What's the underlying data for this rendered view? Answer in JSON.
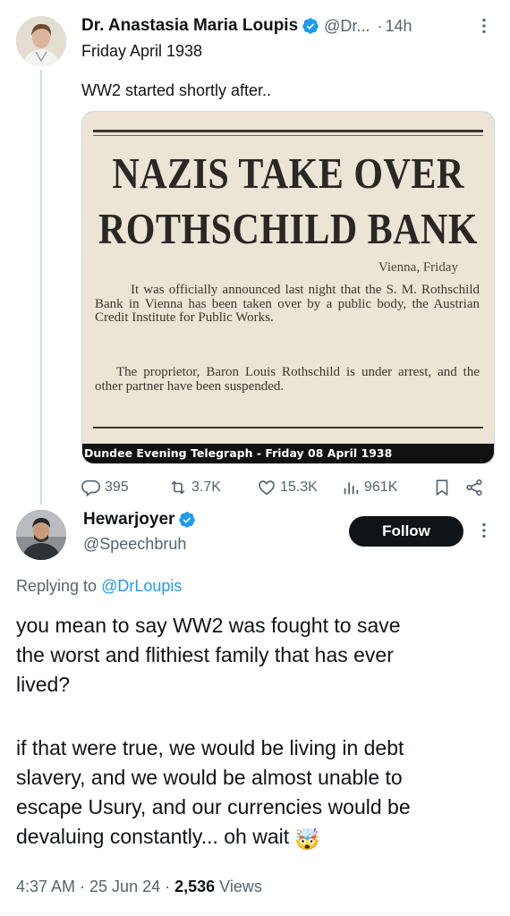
{
  "parent_tweet": {
    "author_name": "Dr. Anastasia Maria Loupis",
    "handle": "@Dr...",
    "time": "14h",
    "line1": "Friday April 1938",
    "line2": "WW2 started shortly after..",
    "media": {
      "headline1": "NAZIS TAKE OVER",
      "headline2": "ROTHSCHILD BANK",
      "dateline": "Vienna, Friday",
      "paragraph1": "It was officially announced last night that the S. M. Rothschild Bank in Vienna has been taken over by a public body, the Austrian Credit Institute for Public Works.",
      "paragraph2": "The proprietor, Baron Louis Rothschild is under arrest, and the other partner have been suspended.",
      "caption": "Dundee Evening Telegraph - Friday 08 April 1938"
    },
    "stats": {
      "replies": "395",
      "retweets": "3.7K",
      "likes": "15.3K",
      "views": "961K"
    },
    "colors": {
      "verified": "#1d9bf0",
      "secondary_text": "#536471",
      "thread_line": "#cfd9de"
    }
  },
  "reply_tweet": {
    "author_name": "Hewarjoyer",
    "handle": "@Speechbruh",
    "follow_label": "Follow",
    "replying_prefix": "Replying to",
    "replying_mention": "@DrLoupis",
    "lines": [
      "you mean to say WW2 was fought to save",
      "the worst and flithiest family that has ever",
      "lived?",
      "if that were true, we would be living in debt",
      "slavery, and we would be almost unable to",
      "escape Usury, and our currencies would be",
      "devaluing constantly... oh wait"
    ],
    "emoji": "🤯",
    "timestamp": "4:37 AM · 25 Jun 24 · ",
    "views_count": "2,536",
    "views_label": " Views",
    "colors": {
      "mention": "#1d9bf0",
      "follow_bg": "#0f1419"
    }
  },
  "icons": [
    "verified-badge-icon",
    "more-icon",
    "reply-icon",
    "retweet-icon",
    "like-icon",
    "views-icon",
    "bookmark-icon",
    "share-icon",
    "exploding-head-emoji"
  ]
}
